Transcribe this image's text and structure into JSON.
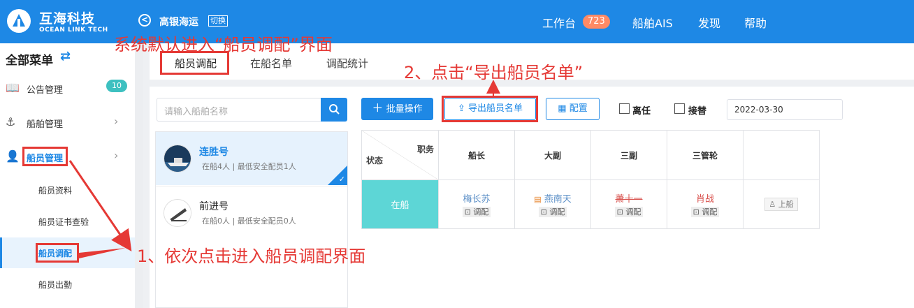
{
  "app": {
    "brand": "互海科技",
    "brand_sub": "OCEAN LINK TECH",
    "company": "高银海运",
    "switch": "切换",
    "back_icon": "back-icon"
  },
  "nav": {
    "workbench": "工作台",
    "badge": "723",
    "ais": "船舶AIS",
    "discover": "发现",
    "help": "帮助"
  },
  "sidebar": {
    "title": "全部菜单",
    "items": [
      {
        "label": "公告管理",
        "badge": "10",
        "icon": "book-icon"
      },
      {
        "label": "船舶管理",
        "icon": "anchor-icon"
      },
      {
        "label": "船员管理",
        "icon": "user-icon"
      }
    ],
    "sub_items": [
      "船员资料",
      "船员证书查验",
      "船员调配",
      "船员出勤"
    ]
  },
  "tabs": [
    "船员调配",
    "在船名单",
    "调配统计"
  ],
  "search": {
    "placeholder": "请输入船舶名称"
  },
  "ships": [
    {
      "name": "连胜号",
      "info": "在船4人 | 最低安全配员1人"
    },
    {
      "name": "前进号",
      "info": "在船0人 | 最低安全配员0人"
    }
  ],
  "toolbar": {
    "batch": "批量操作",
    "export": "导出船员名单",
    "config": "配置",
    "leave": "离任",
    "replace": "接替",
    "date": "2022-03-30"
  },
  "grid": {
    "corner_top": "职务",
    "corner_bottom": "状态",
    "headers": [
      "船长",
      "大副",
      "三副",
      "三管轮",
      ""
    ],
    "state": "在船",
    "cells": [
      {
        "name": "梅长苏",
        "tag": "调配"
      },
      {
        "name": "燕南天",
        "tag": "调配"
      },
      {
        "name": "萧十一",
        "tag": "调配"
      },
      {
        "name": "肖战",
        "tag": "调配"
      }
    ],
    "board": "上船"
  },
  "annotations": {
    "default": "系统默认进入“船员调配”界面",
    "step2": "2、点击“导出船员名单”",
    "step1": "1、依次点击进入船员调配界面"
  },
  "colors": {
    "primary": "#1e88e5",
    "annotation": "#e53935",
    "state": "#5dd6d6"
  }
}
